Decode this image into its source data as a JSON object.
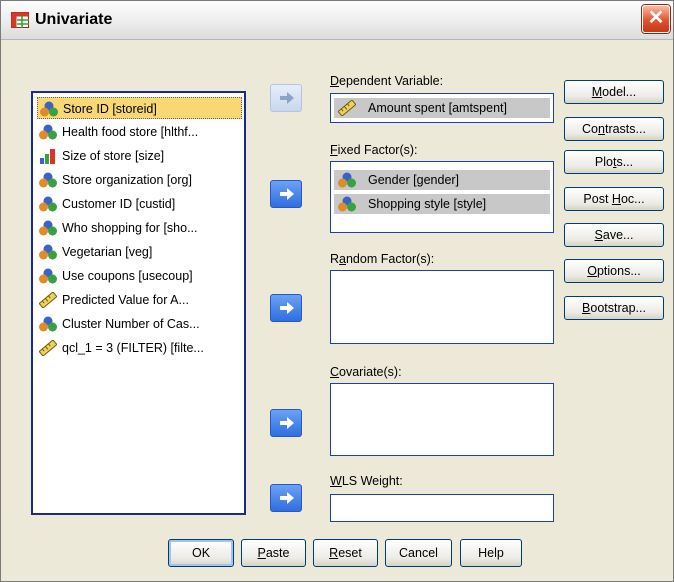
{
  "window": {
    "title": "Univariate",
    "close_symbol": "✕"
  },
  "variables": [
    {
      "label": "Store ID [storeid]",
      "icon": "nominal-icon",
      "selected": true
    },
    {
      "label": "Health food store [hlthf...",
      "icon": "nominal-icon"
    },
    {
      "label": "Size of store [size]",
      "icon": "ordinal-icon"
    },
    {
      "label": "Store organization [org]",
      "icon": "nominal-icon"
    },
    {
      "label": "Customer ID [custid]",
      "icon": "nominal-icon"
    },
    {
      "label": "Who shopping for [sho...",
      "icon": "nominal-icon"
    },
    {
      "label": "Vegetarian [veg]",
      "icon": "nominal-icon"
    },
    {
      "label": "Use coupons [usecoup]",
      "icon": "nominal-icon"
    },
    {
      "label": "Predicted Value for A...",
      "icon": "scale-ruler-icon"
    },
    {
      "label": "Cluster Number of Cas...",
      "icon": "nominal-icon"
    },
    {
      "label": "qcl_1 = 3 (FILTER) [filte...",
      "icon": "scale-ruler-icon"
    }
  ],
  "dependent": {
    "label_pre": "",
    "label_ul": "D",
    "label_post": "ependent Variable:",
    "value": "Amount spent [amtspent]"
  },
  "fixed": {
    "label_pre": "",
    "label_ul": "F",
    "label_post": "ixed Factor(s):",
    "items": [
      "Gender [gender]",
      "Shopping style [style]"
    ]
  },
  "random": {
    "label_pre": "R",
    "label_ul": "a",
    "label_post": "ndom Factor(s):"
  },
  "covariate": {
    "label_pre": "",
    "label_ul": "C",
    "label_post": "ovariate(s):"
  },
  "wls": {
    "label_pre": "",
    "label_ul": "W",
    "label_post": "LS Weight:"
  },
  "side_buttons": [
    {
      "pre": "",
      "ul": "M",
      "post": "odel..."
    },
    {
      "pre": "Co",
      "ul": "n",
      "post": "trasts..."
    },
    {
      "pre": "Plo",
      "ul": "t",
      "post": "s..."
    },
    {
      "pre": "Post ",
      "ul": "H",
      "post": "oc..."
    },
    {
      "pre": "",
      "ul": "S",
      "post": "ave..."
    },
    {
      "pre": "",
      "ul": "O",
      "post": "ptions..."
    },
    {
      "pre": "",
      "ul": "B",
      "post": "ootstrap..."
    }
  ],
  "bottom_buttons": [
    {
      "pre": "OK",
      "ul": "",
      "post": ""
    },
    {
      "pre": "",
      "ul": "P",
      "post": "aste"
    },
    {
      "pre": "",
      "ul": "R",
      "post": "eset"
    },
    {
      "pre": "Cancel",
      "ul": "",
      "post": ""
    },
    {
      "pre": "Help",
      "ul": "",
      "post": ""
    }
  ],
  "colors": {
    "selection": "#f8d874",
    "arrow_active": "#2e6ee0",
    "list_border": "#1c2a8a"
  }
}
